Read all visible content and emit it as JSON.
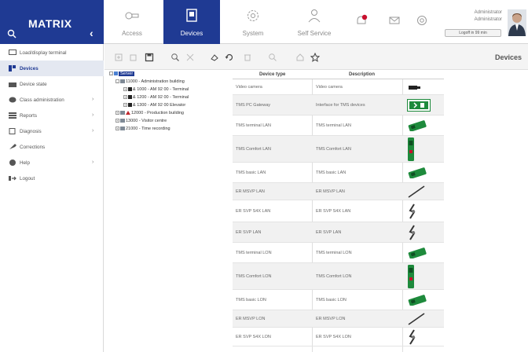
{
  "brand": {
    "name": "MATRIX"
  },
  "nav": [
    {
      "label": "Access",
      "icon": "key-icon",
      "active": false
    },
    {
      "label": "Devices",
      "icon": "device-icon",
      "active": true
    },
    {
      "label": "System",
      "icon": "gear-icon",
      "active": false
    },
    {
      "label": "Self Service",
      "icon": "person-icon",
      "active": false
    }
  ],
  "user": {
    "line1": "Administrator",
    "line2": "Administrator",
    "logoff": "Logoff in 99 min"
  },
  "sidebar": {
    "items": [
      {
        "label": "Load/display terminal",
        "icon": "monitor-icon",
        "arrow": false,
        "active": false
      },
      {
        "label": "Devices",
        "icon": "devices-icon",
        "arrow": false,
        "active": true
      },
      {
        "label": "Device state",
        "icon": "device-state-icon",
        "arrow": false,
        "active": false
      },
      {
        "label": "Class administration",
        "icon": "class-icon",
        "arrow": true,
        "active": false
      },
      {
        "label": "Reports",
        "icon": "reports-icon",
        "arrow": true,
        "active": false
      },
      {
        "label": "Diagnosis",
        "icon": "diagnosis-icon",
        "arrow": true,
        "active": false
      },
      {
        "label": "Corrections",
        "icon": "wrench-icon",
        "arrow": false,
        "active": false
      },
      {
        "label": "Help",
        "icon": "help-icon",
        "arrow": true,
        "active": false
      },
      {
        "label": "Logout",
        "icon": "logout-icon",
        "arrow": false,
        "active": false
      }
    ]
  },
  "toolbar": {
    "title": "Devices"
  },
  "tree": {
    "root": "Server",
    "nodes": [
      {
        "label": "11000 - Administration building",
        "level": 1,
        "kind": "folder"
      },
      {
        "label": "& 1000 - AM 92 00 - Terminal",
        "level": 2,
        "kind": "device"
      },
      {
        "label": "& 1200 - AM 92 00 - Terminal",
        "level": 2,
        "kind": "device"
      },
      {
        "label": "& 1300 - AM 92 00 Elevator",
        "level": 2,
        "kind": "device"
      },
      {
        "label": "12000 - Production building",
        "level": 1,
        "kind": "warning"
      },
      {
        "label": "13000 - Visitor centre",
        "level": 1,
        "kind": "folder"
      },
      {
        "label": "21000 - Time recording",
        "level": 1,
        "kind": "folder"
      }
    ]
  },
  "table": {
    "headers": [
      "Device type",
      "Description"
    ],
    "rows": [
      {
        "type": "Video camera",
        "desc": "Video camera",
        "pic": "camera"
      },
      {
        "type": "TMS PC Gateway",
        "desc": "Interface for TMS devices",
        "pic": "exit-sign"
      },
      {
        "type": "TMS terminal LAN",
        "desc": "TMS terminal LAN",
        "pic": "green-reader"
      },
      {
        "type": "TMS Comfort LAN",
        "desc": "TMS Comfort LAN",
        "pic": "tall-reader"
      },
      {
        "type": "TMS basic LAN",
        "desc": "TMS basic LAN",
        "pic": "green-reader"
      },
      {
        "type": "ER MSVP LAN",
        "desc": "ER MSVP LAN",
        "pic": "rod"
      },
      {
        "type": "ER SVP S4X LAN",
        "desc": "ER SVP S4X LAN",
        "pic": "lock"
      },
      {
        "type": "ER SVP LAN",
        "desc": "ER SVP LAN",
        "pic": "lock"
      },
      {
        "type": "TMS terminal LON",
        "desc": "TMS terminal LON",
        "pic": "green-reader"
      },
      {
        "type": "TMS Comfort LON",
        "desc": "TMS Comfort LON",
        "pic": "tall-reader"
      },
      {
        "type": "TMS basic LON",
        "desc": "TMS basic LON",
        "pic": "green-reader"
      },
      {
        "type": "ER MSVP LON",
        "desc": "ER MSVP LON",
        "pic": "rod"
      },
      {
        "type": "ER SVP S4X LON",
        "desc": "ER SVP S4X LON",
        "pic": "lock"
      }
    ]
  },
  "colors": {
    "brand": "#1f3a93",
    "notify": "#c8102e",
    "reader_green": "#1e8a3c"
  }
}
